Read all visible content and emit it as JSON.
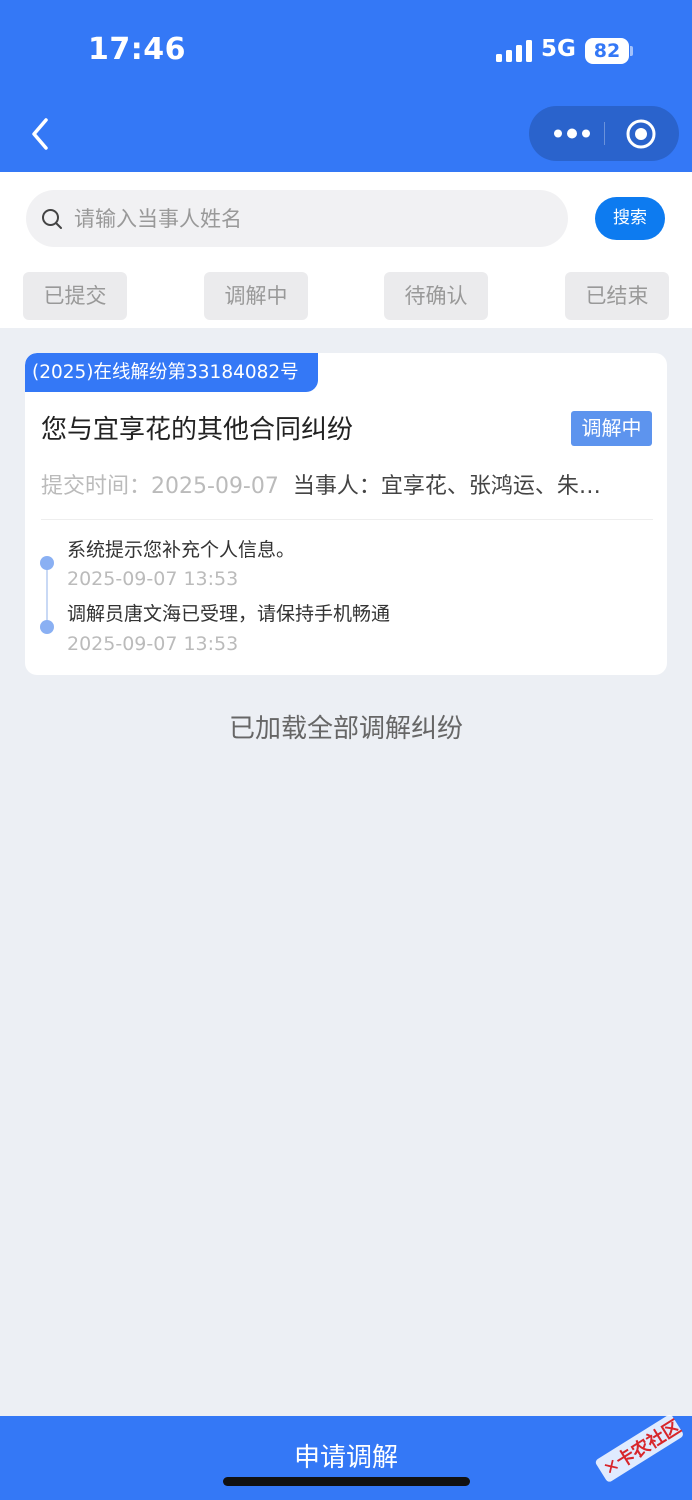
{
  "status_bar": {
    "time": "17:46",
    "network": "5G",
    "battery": "82"
  },
  "nav": {
    "back_icon": "chevron-left-icon",
    "more_icon": "more-dots-icon",
    "close_icon": "target-circle-icon"
  },
  "search": {
    "placeholder": "请输入当事人姓名",
    "button_label": "搜索"
  },
  "tabs": [
    "已提交",
    "调解中",
    "待确认",
    "已结束"
  ],
  "case": {
    "number": "(2025)在线解纷第33184082号",
    "title": "您与宜享花的其他合同纠纷",
    "status": "调解中",
    "submit_time_label": "提交时间：",
    "submit_time": "2025-09-07",
    "parties_label": "当事人：",
    "parties": "宜享花、张鸿运、朱…",
    "timeline": [
      {
        "text": "系统提示您补充个人信息。",
        "time": "2025-09-07 13:53"
      },
      {
        "text": "调解员唐文海已受理，请保持手机畅通",
        "time": "2025-09-07 13:53"
      }
    ]
  },
  "list_footer": "已加载全部调解纠纷",
  "bottom_button": "申请调解",
  "watermark": "卡农社区",
  "colors": {
    "primary": "#3478f6",
    "search_button": "#0d7bf0",
    "badge": "#5d94ee",
    "page_bg": "#eceff4"
  }
}
